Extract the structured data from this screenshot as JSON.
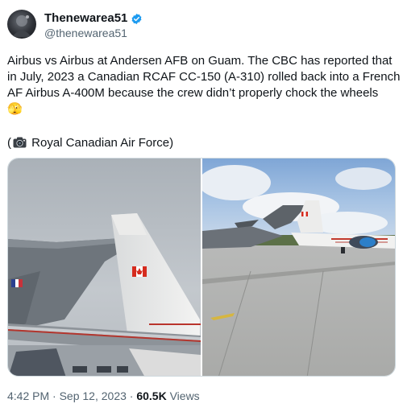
{
  "author": {
    "display_name": "Thenewarea51",
    "handle": "@thenewarea51",
    "verified_icon": "verified-badge-icon"
  },
  "tweet": {
    "lines": [
      "Airbus vs Airbus at Andersen AFB on Guam. The CBC has reported that",
      "in July, 2023 a Canadian RCAF CC-150 (A-310) rolled back into a French",
      "AF Airbus A-400M because the crew didn’t properly chock the wheels"
    ],
    "emoji": "🫣",
    "credit_open": "(",
    "credit_text": " Royal Canadian Air Force)"
  },
  "media": {
    "left_photo_icon": "aircraft-tails-photo",
    "right_photo_icon": "aircraft-on-ramp-photo"
  },
  "meta": {
    "time": "4:42 PM",
    "sep1": " · ",
    "date": "Sep 12, 2023",
    "sep2": " · ",
    "views_count": "60.5K",
    "views_label": " Views"
  },
  "colors": {
    "verified_blue": "#1d9bf0",
    "text": "#0f1419",
    "secondary": "#536471"
  }
}
